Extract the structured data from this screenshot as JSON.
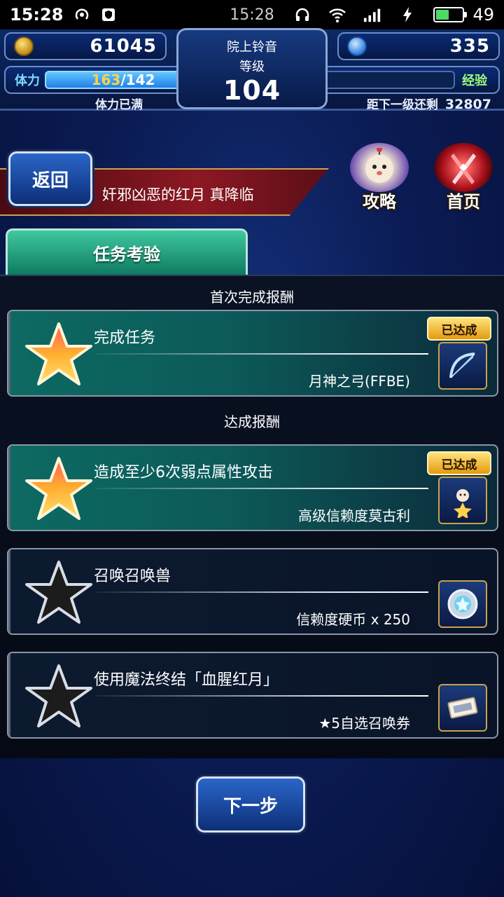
{
  "status_bar": {
    "time_left": "15:28",
    "time_center": "15:28",
    "battery": "49",
    "icons": [
      "hotspot-icon",
      "shield-icon",
      "headphones-icon",
      "wifi-icon",
      "signal-icon",
      "charging-icon",
      "battery-icon"
    ]
  },
  "header": {
    "gil": "61045",
    "gems": "335",
    "player_name": "院上铃音",
    "level_label": "等级",
    "level": "104",
    "stamina_label": "体力",
    "stamina_current": "163",
    "stamina_max": "/142",
    "stamina_status": "体力已满",
    "exp_label": "经验",
    "exp_fill": 0.13,
    "exp_remaining_label": "距下一级还剩",
    "exp_remaining": "32807"
  },
  "nav": {
    "back_label": "返回",
    "quest_title": "奸邪凶恶的红月 真降临",
    "guide_label": "攻略",
    "home_label": "首页"
  },
  "tab": {
    "label": "任务考验"
  },
  "sections": {
    "first_clear": "首次完成报酬",
    "achievement": "达成报酬"
  },
  "missions": [
    {
      "title": "完成任务",
      "reward": "月神之弓(FFBE)",
      "badge": "已达成",
      "icon": "bow-icon",
      "completed": true
    },
    {
      "title": "造成至少6次弱点属性攻击",
      "reward": "高级信赖度莫古利",
      "badge": "已达成",
      "icon": "moogle-icon",
      "completed": true
    },
    {
      "title": "召唤召唤兽",
      "reward": "信赖度硬币 x 250",
      "badge": "",
      "icon": "coin-icon",
      "completed": false
    },
    {
      "title": "使用魔法终结「血腥红月」",
      "reward": "★5自选召唤券",
      "badge": "",
      "icon": "ticket-icon",
      "completed": false
    }
  ],
  "footer": {
    "next_label": "下一步"
  },
  "colors": {
    "accent_blue": "#2a66c8",
    "done_teal": "#0d6a62",
    "badge_gold": "#ffe27a",
    "banner_red": "#8c1822"
  }
}
